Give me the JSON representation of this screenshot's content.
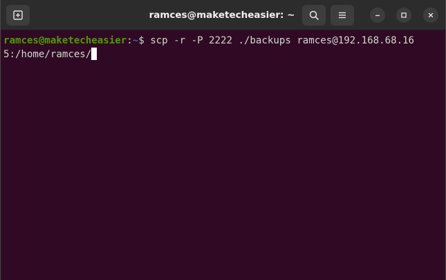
{
  "window": {
    "title": "ramces@maketecheasier: ~"
  },
  "terminal": {
    "prompt_user_host": "ramces@maketecheasier",
    "prompt_colon": ":",
    "prompt_path": "~",
    "prompt_symbol": "$ ",
    "command_line1": "scp -r -P 2222 ./backups ramces@192.168.68.16",
    "command_line2": "5:/home/ramces/"
  },
  "icons": {
    "new_tab": "new-tab-icon",
    "search": "search-icon",
    "menu": "hamburger-menu-icon",
    "minimize": "minimize-icon",
    "maximize": "maximize-icon",
    "close": "close-icon"
  },
  "colors": {
    "terminal_background": "#300a24",
    "titlebar": "#2c2c2c",
    "prompt_user": "#4e9a06",
    "prompt_path": "#3465a4",
    "text": "#d3d7cf"
  }
}
